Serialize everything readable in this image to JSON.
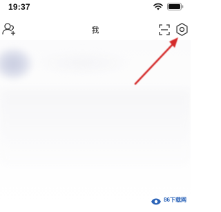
{
  "status_bar": {
    "time": "19:37"
  },
  "nav": {
    "title": "我",
    "left_icon": "add-friend-icon",
    "right_icons": [
      "scan-icon",
      "settings-icon"
    ]
  },
  "annotation": {
    "arrow_color": "#d42a2a",
    "points_to": "settings-icon"
  },
  "watermark": {
    "text": "86下载网"
  },
  "colors": {
    "background": "#ffffff",
    "icon": "#333333",
    "watermark": "#2b63b8"
  }
}
